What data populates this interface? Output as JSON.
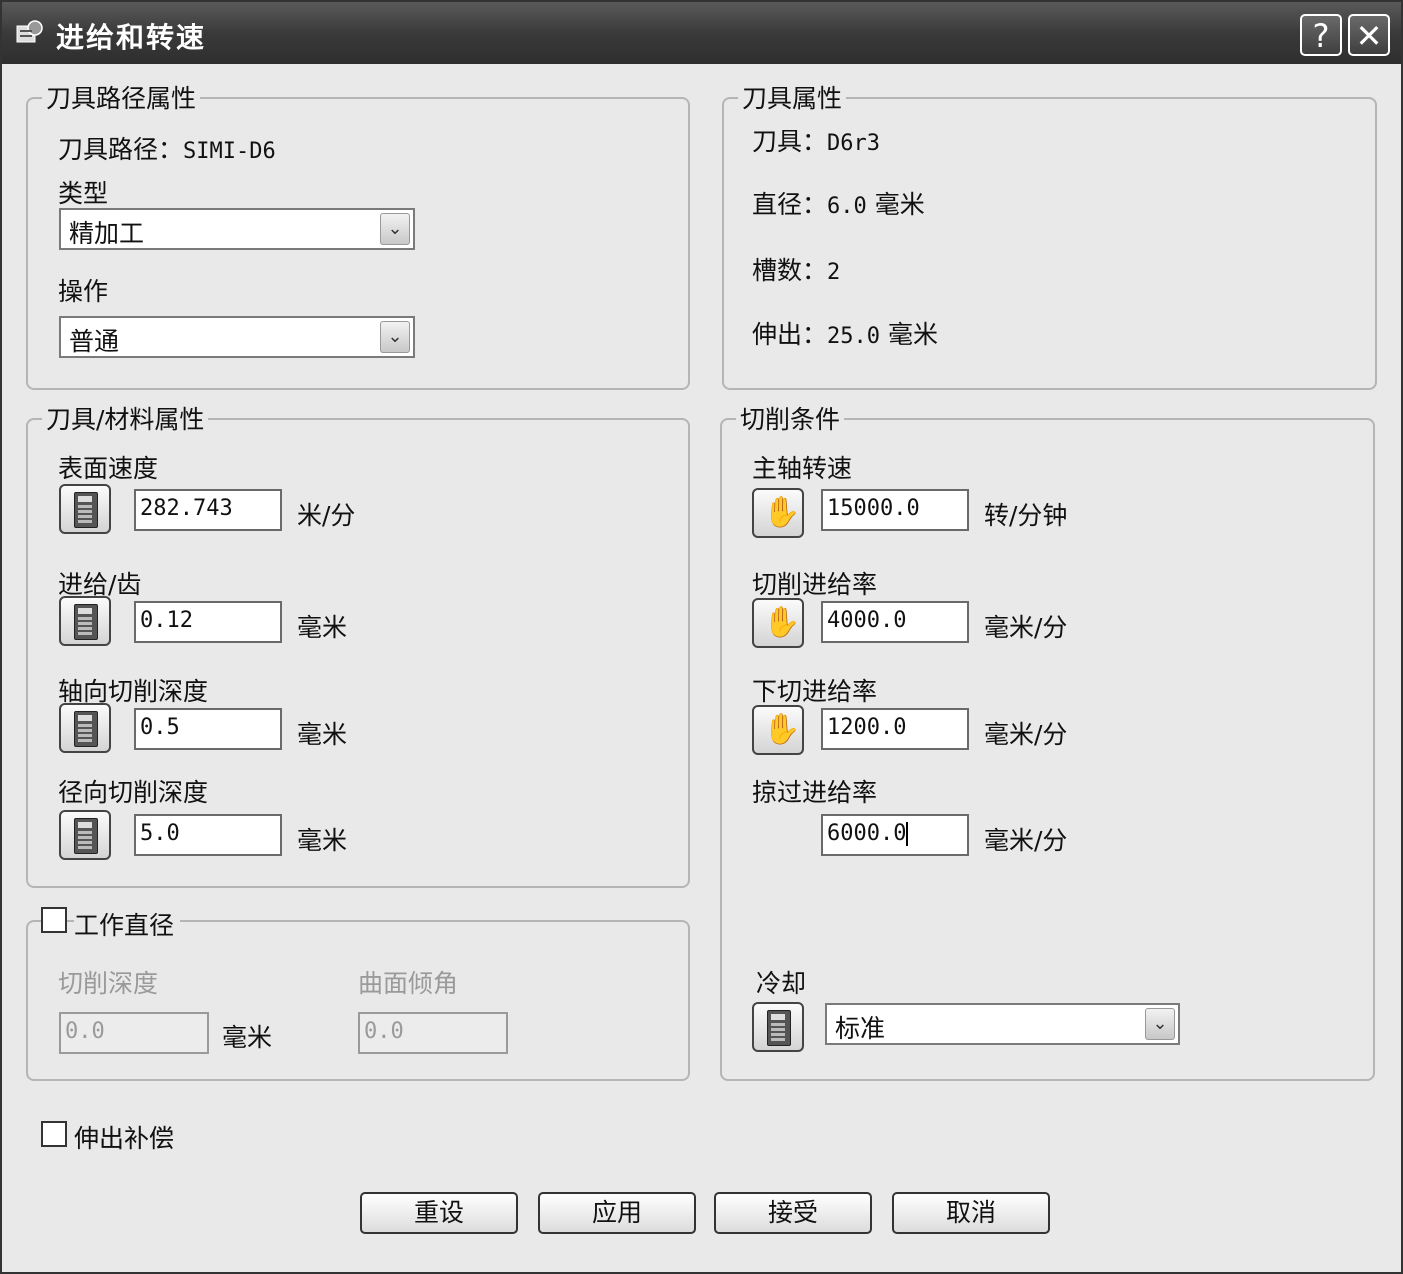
{
  "window": {
    "title": "进给和转速",
    "help_label": "?",
    "close_label": "✕",
    "icon": "cutter-tool-icon"
  },
  "toolpath_props": {
    "legend": "刀具路径属性",
    "toolpath_label": "刀具路径：",
    "toolpath_value": "SIMI-D6",
    "type_label": "类型",
    "type_value": "精加工",
    "operation_label": "操作",
    "operation_value": "普通"
  },
  "tool_props": {
    "legend": "刀具属性",
    "tool_label": "刀具：",
    "tool_value": "D6r3",
    "diameter_label": "直径：",
    "diameter_value": "6.0",
    "diameter_unit": "毫米",
    "flutes_label": "槽数：",
    "flutes_value": "2",
    "overhang_label": "伸出：",
    "overhang_value": "25.0",
    "overhang_unit": "毫米"
  },
  "material_props": {
    "legend": "刀具/材料属性",
    "surface_speed_label": "表面速度",
    "surface_speed_value": "282.743",
    "surface_speed_unit": "米/分",
    "feed_per_tooth_label": "进给/齿",
    "feed_per_tooth_value": "0.12",
    "feed_per_tooth_unit": "毫米",
    "axial_depth_label": "轴向切削深度",
    "axial_depth_value": "0.5",
    "axial_depth_unit": "毫米",
    "radial_depth_label": "径向切削深度",
    "radial_depth_value": "5.0",
    "radial_depth_unit": "毫米"
  },
  "working_diameter": {
    "legend": "工作直径",
    "checked": false,
    "cut_depth_label": "切削深度",
    "cut_depth_value": "0.0",
    "cut_depth_unit": "毫米",
    "surface_angle_label": "曲面倾角",
    "surface_angle_value": "0.0"
  },
  "cutting_conditions": {
    "legend": "切削条件",
    "spindle_label": "主轴转速",
    "spindle_value": "15000.0",
    "spindle_unit": "转/分钟",
    "cutting_feed_label": "切削进给率",
    "cutting_feed_value": "4000.0",
    "cutting_feed_unit": "毫米/分",
    "plunge_feed_label": "下切进给率",
    "plunge_feed_value": "1200.0",
    "plunge_feed_unit": "毫米/分",
    "skim_feed_label": "掠过进给率",
    "skim_feed_value": "6000.0",
    "skim_feed_unit": "毫米/分",
    "coolant_label": "冷却",
    "coolant_value": "标准"
  },
  "overhang_comp": {
    "label": "伸出补偿",
    "checked": false
  },
  "buttons": {
    "reset": "重设",
    "apply": "应用",
    "accept": "接受",
    "cancel": "取消"
  }
}
